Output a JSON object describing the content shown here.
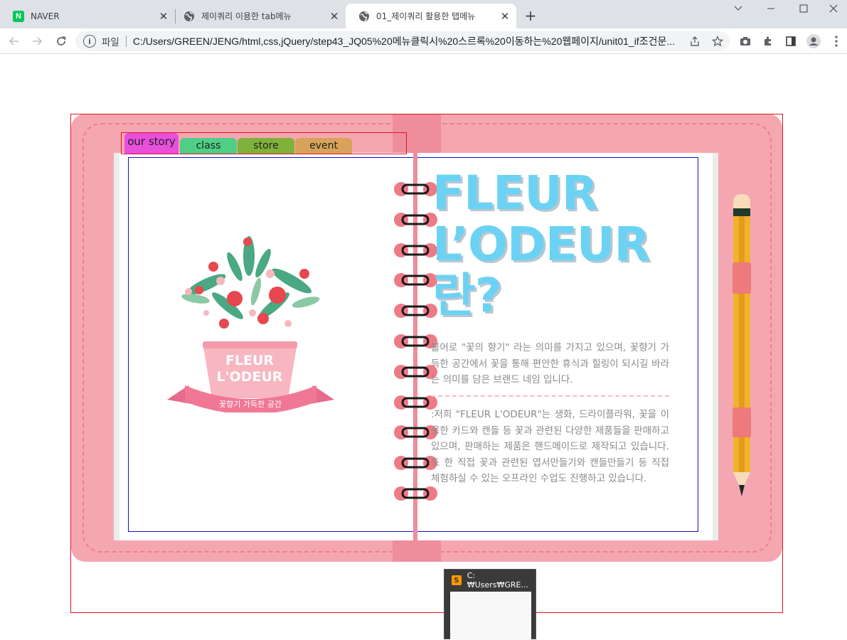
{
  "browser": {
    "tabs": [
      {
        "title": "NAVER",
        "icon": "naver-icon"
      },
      {
        "title": "제이쿼리 이용한 tab메뉴",
        "icon": "globe-icon"
      },
      {
        "title": "01_제이쿼리 활용한 탭메뉴",
        "icon": "globe-icon",
        "active": true
      }
    ],
    "new_tab_label": "+",
    "address": {
      "scheme_label": "파일",
      "url": "C:/Users/GREEN/JENG/html,css,jQuery/step43_JQ05%20메뉴클릭시%20스르록%20이동하는%20웹페이지/unit01_if조건문..."
    }
  },
  "page": {
    "tab_menu": [
      {
        "label": "our story",
        "color": "#e84fdd",
        "active": true
      },
      {
        "label": "class",
        "color": "#4fcf85"
      },
      {
        "label": "store",
        "color": "#7fb23a"
      },
      {
        "label": "event",
        "color": "#d8a25a"
      }
    ],
    "illustration": {
      "brand_line1": "FLEUR",
      "brand_line2": "L'ODEUR",
      "ribbon_text": "꽃향기 가득한 공간"
    },
    "title_lines": [
      "FLEUR",
      "L’ODEUR",
      "란?"
    ],
    "paragraph1": "불어로 \"꽃의 향기\" 라는 의미를 가지고 있으며, 꽃향기 가득한 공간에서 꽃을 통해 편안한 휴식과 힐링이 되시길 바라는 의미를 담은 브랜드 네임 입니다.",
    "paragraph2": ":저희 \"FLEUR L'ODEUR\"는 생화, 드라이플라워, 꽃을 이용한 카드와 캔들 등 꽃과 관련된 다양한 제품들을 판매하고 있으며, 판매하는 제품은 핸드메이드로 제작되고 있습니다. 또 한 직접 꽃과 관련된 엽서만들기와 캔들만들기 등 직접 체험하실 수 있는 오프라인 수업도 진행하고 있습니다.",
    "colors": {
      "planner": "#f5a7b1",
      "title": "#6cd2f4",
      "text": "#8a8a8a"
    }
  },
  "taskbar_preview": {
    "title": "C:₩Users₩GRE..."
  }
}
